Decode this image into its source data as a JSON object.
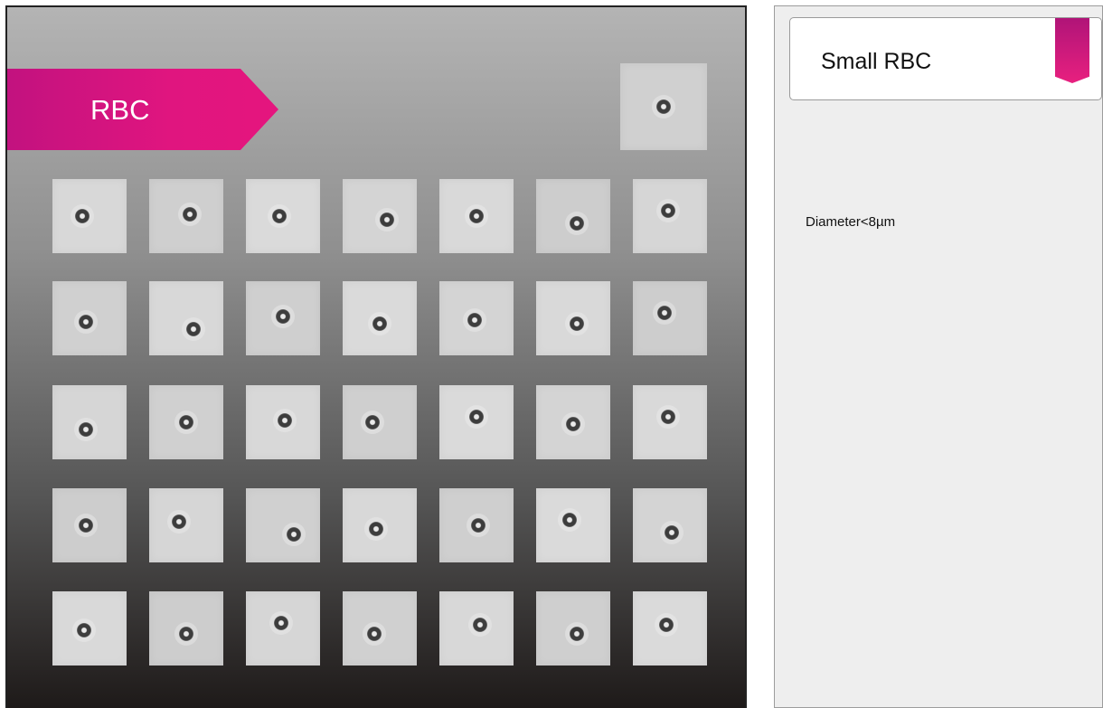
{
  "gallery": {
    "banner_label": "RBC",
    "cell_count": 36
  },
  "info": {
    "title": "Small RBC",
    "description": "Diameter<8µm"
  }
}
